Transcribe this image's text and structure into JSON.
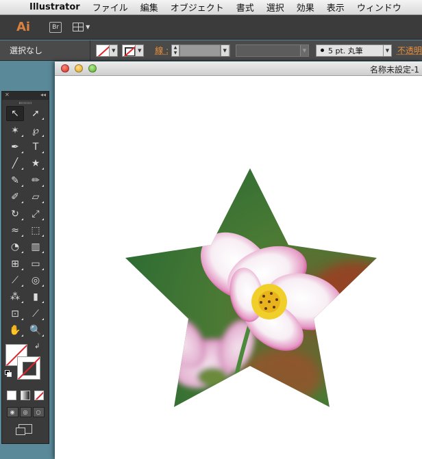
{
  "menubar": {
    "app_name": "Illustrator",
    "items": [
      "ファイル",
      "編集",
      "オブジェクト",
      "書式",
      "選択",
      "効果",
      "表示",
      "ウィンドウ"
    ]
  },
  "appbar": {
    "app_logo": "Ai",
    "bridge_label": "Br"
  },
  "control_bar": {
    "selection_status": "選択なし",
    "stroke_label": "線 :",
    "brush_label": "5 pt. 丸筆",
    "opacity_label": "不透明"
  },
  "document": {
    "title": "名称未設定-1"
  },
  "tools": {
    "rows": [
      [
        "selection-tool",
        "direct-selection-tool"
      ],
      [
        "magic-wand-tool",
        "lasso-tool"
      ],
      [
        "pen-tool",
        "type-tool"
      ],
      [
        "line-segment-tool",
        "star-tool"
      ],
      [
        "paintbrush-tool",
        "pencil-tool"
      ],
      [
        "blob-brush-tool",
        "eraser-tool"
      ],
      [
        "rotate-tool",
        "scale-tool"
      ],
      [
        "width-tool",
        "free-transform-tool"
      ],
      [
        "shape-builder-tool",
        "perspective-grid-tool"
      ],
      [
        "mesh-tool",
        "gradient-tool"
      ],
      [
        "eyedropper-tool",
        "blend-tool"
      ],
      [
        "symbol-sprayer-tool",
        "column-graph-tool"
      ],
      [
        "artboard-tool",
        "slice-tool"
      ],
      [
        "hand-tool",
        "zoom-tool"
      ]
    ],
    "glyphs": {
      "selection-tool": "↖",
      "direct-selection-tool": "➚",
      "magic-wand-tool": "✶",
      "lasso-tool": "℘",
      "pen-tool": "✒",
      "type-tool": "T",
      "line-segment-tool": "╱",
      "star-tool": "★",
      "paintbrush-tool": "✎",
      "pencil-tool": "✏",
      "blob-brush-tool": "✐",
      "eraser-tool": "▱",
      "rotate-tool": "↻",
      "scale-tool": "⤢",
      "width-tool": "≈",
      "free-transform-tool": "⬚",
      "shape-builder-tool": "◔",
      "perspective-grid-tool": "▥",
      "mesh-tool": "⊞",
      "gradient-tool": "▭",
      "eyedropper-tool": "⟋",
      "blend-tool": "◎",
      "symbol-sprayer-tool": "⁂",
      "column-graph-tool": "▮",
      "artboard-tool": "⊡",
      "slice-tool": "⟋",
      "hand-tool": "✋",
      "zoom-tool": "🔍"
    }
  },
  "colors": {
    "ai_orange": "#d9813f",
    "control_orange": "#e9913a",
    "star_green": "#3f7e3a"
  }
}
